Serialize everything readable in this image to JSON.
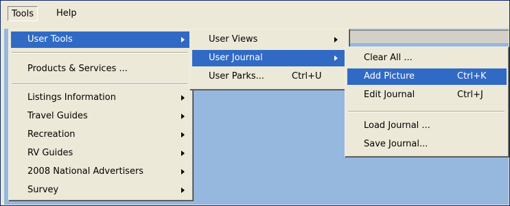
{
  "menubar": {
    "tools_label": "Tools",
    "help_label": "Help"
  },
  "tools_menu": {
    "items": [
      {
        "label": "User Tools",
        "submenu": true,
        "highlighted": true
      },
      {
        "label": "Products & Services ..."
      },
      {
        "label": "Listings Information",
        "submenu": true
      },
      {
        "label": "Travel Guides",
        "submenu": true
      },
      {
        "label": "Recreation",
        "submenu": true
      },
      {
        "label": "RV Guides",
        "submenu": true
      },
      {
        "label": "2008 National Advertisers",
        "submenu": true
      },
      {
        "label": "Survey",
        "submenu": true
      }
    ]
  },
  "user_tools_menu": {
    "items": [
      {
        "label": "User Views",
        "submenu": true
      },
      {
        "label": "User Journal",
        "submenu": true,
        "highlighted": true
      },
      {
        "label": "User Parks...",
        "shortcut": "Ctrl+U"
      }
    ]
  },
  "user_journal_menu": {
    "items": [
      {
        "label": "Clear All ..."
      },
      {
        "label": "Add Picture",
        "shortcut": "Ctrl+K",
        "highlighted": true
      },
      {
        "label": "Edit Journal",
        "shortcut": "Ctrl+J"
      },
      {
        "label": "Load Journal ..."
      },
      {
        "label": "Save Journal..."
      }
    ]
  },
  "colors": {
    "highlight": "#316ac5",
    "menu_bg": "#ece9d8",
    "client_bg": "#96b7de"
  }
}
